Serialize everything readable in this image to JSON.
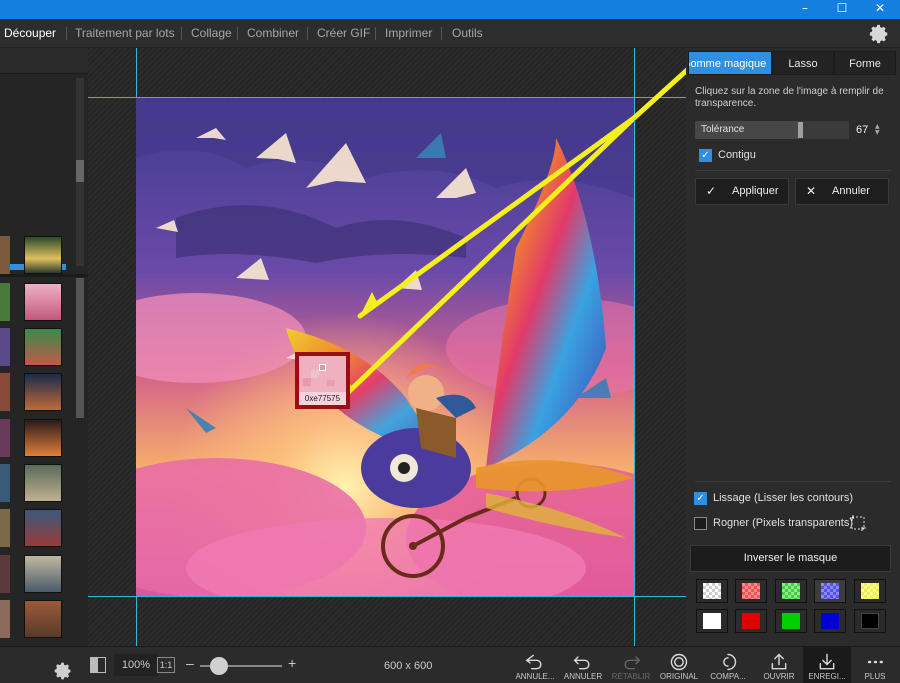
{
  "menu": {
    "items": [
      "Découper",
      "Traitement par lots",
      "Collage",
      "Combiner",
      "Créer GIF",
      "Imprimer",
      "Outils"
    ]
  },
  "window_controls": [
    "–",
    "☐",
    "✕"
  ],
  "tools": {
    "tabs": [
      "Gomme magique",
      "Lasso",
      "Forme"
    ],
    "hint": "Cliquez sur la zone de l'image à remplir de transparence.",
    "tolerance_label": "Tolérance",
    "tolerance_value": "67",
    "contiguous_label": "Contigu",
    "apply_label": "Appliquer",
    "cancel_label": "Annuler"
  },
  "options": {
    "smoothing_label": "Lissage (Lisser les contours)",
    "crop_label": "Rogner (Pixels transparents)",
    "invert_label": "Inverser le masque"
  },
  "magnifier": {
    "color_code": "0xe77575"
  },
  "status": {
    "zoom": "100%",
    "one_to_one": "1:1",
    "plus": "+",
    "minus": "–",
    "dimensions": "600 x 600"
  },
  "bottom_actions": [
    {
      "label": "ANNULE...",
      "icon": "undo-all-icon"
    },
    {
      "label": "ANNULER",
      "icon": "undo-icon"
    },
    {
      "label": "RÉTABLIR",
      "icon": "redo-icon"
    },
    {
      "label": "ORIGINAL",
      "icon": "original-icon"
    },
    {
      "label": "COMPA...",
      "icon": "compare-icon"
    },
    {
      "label": "OUVRIR",
      "icon": "open-icon"
    },
    {
      "label": "ENREGI...",
      "icon": "save-icon"
    },
    {
      "label": "PLUS",
      "icon": "more-icon"
    }
  ],
  "colors": {
    "accent": "#2f8fe0",
    "mask_red": "#9c0c12",
    "arrow": "#f4f01c",
    "guide": "#34b8d6"
  }
}
